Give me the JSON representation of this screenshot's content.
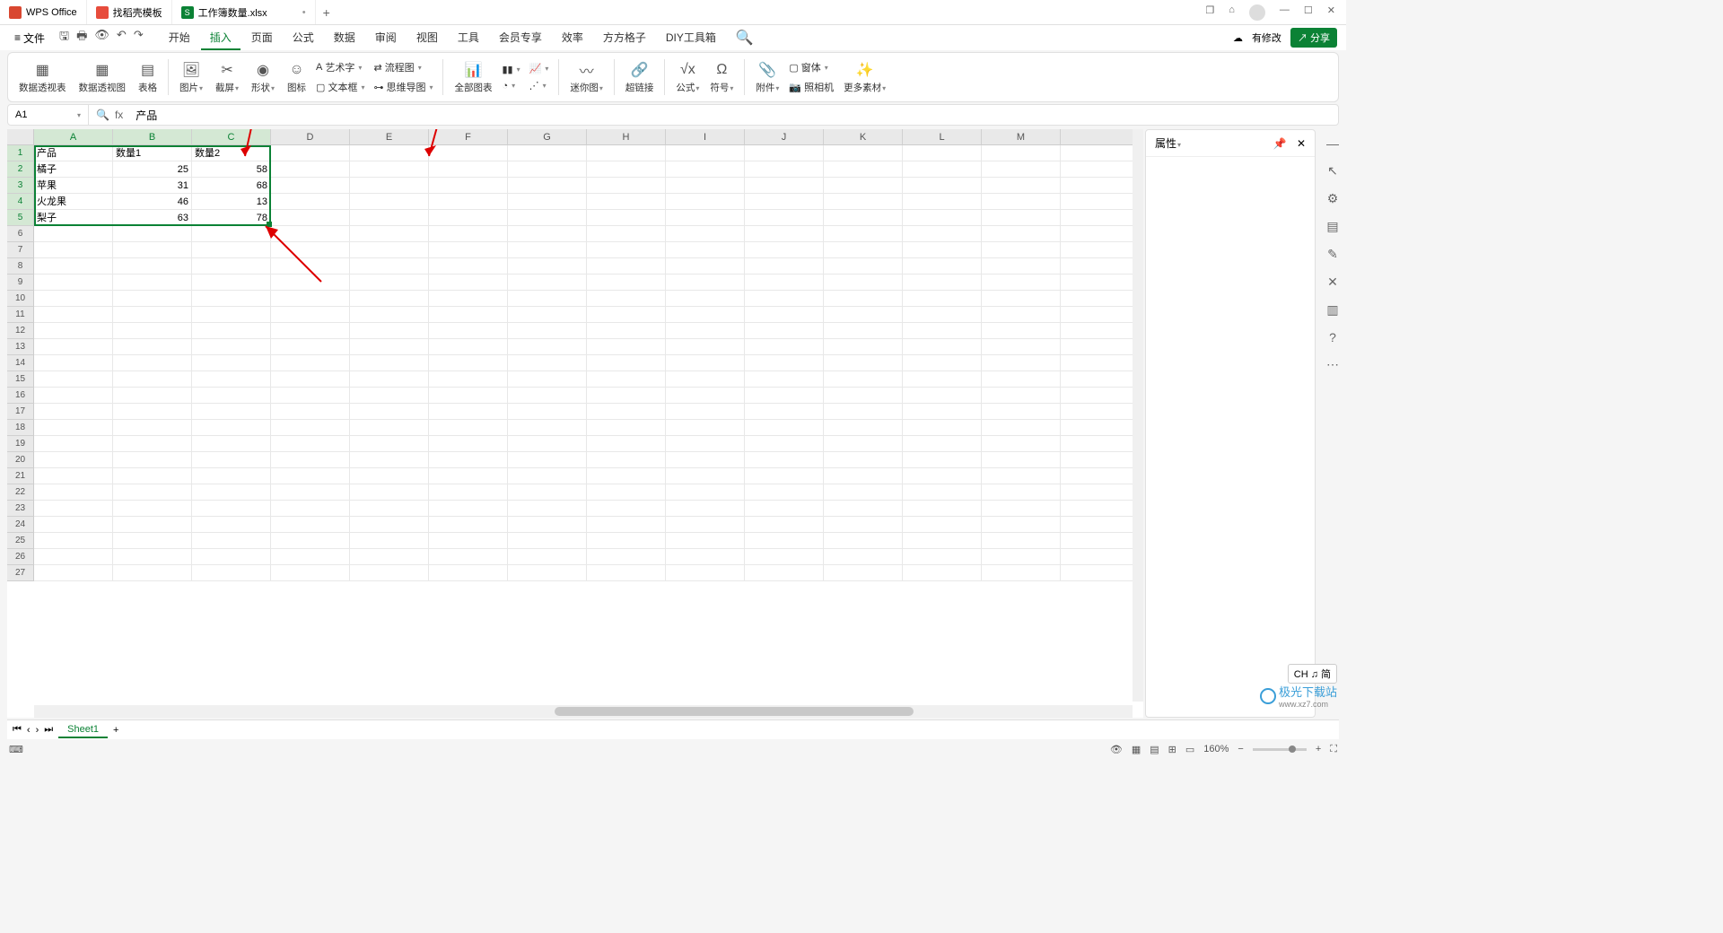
{
  "titlebar": {
    "app_name": "WPS Office",
    "tab_template": "找稻壳模板",
    "tab_file": "工作簿数量.xlsx",
    "add": "+"
  },
  "menubar": {
    "file": "文件",
    "tabs": [
      "开始",
      "插入",
      "页面",
      "公式",
      "数据",
      "审阅",
      "视图",
      "工具",
      "会员专享",
      "效率",
      "方方格子",
      "DIY工具箱"
    ],
    "active_index": 1,
    "has_changes": "有修改",
    "share": "分享"
  },
  "ribbon": {
    "pivot_table": "数据透视表",
    "pivot_chart": "数据透视图",
    "table": "表格",
    "picture": "图片",
    "screenshot": "截屏",
    "shapes": "形状",
    "icons": "图标",
    "wordart": "艺术字",
    "textbox": "文本框",
    "flowchart": "流程图",
    "mindmap": "思维导图",
    "all_charts": "全部图表",
    "sparkline": "迷你图",
    "hyperlink": "超链接",
    "formula": "公式",
    "symbol": "符号",
    "attach": "附件",
    "form": "窗体",
    "camera": "照相机",
    "more": "更多素材"
  },
  "formula_bar": {
    "cell_ref": "A1",
    "content": "产品"
  },
  "chart_data": {
    "type": "table",
    "headers": [
      "产品",
      "数量1",
      "数量2"
    ],
    "rows": [
      [
        "橘子",
        25,
        58
      ],
      [
        "苹果",
        31,
        68
      ],
      [
        "火龙果",
        46,
        13
      ],
      [
        "梨子",
        63,
        78
      ]
    ]
  },
  "columns": [
    "A",
    "B",
    "C",
    "D",
    "E",
    "F",
    "G",
    "H",
    "I",
    "J",
    "K",
    "L",
    "M"
  ],
  "row_count": 27,
  "rpane": {
    "title": "属性"
  },
  "sheetbar": {
    "tab": "Sheet1",
    "add": "+"
  },
  "statusbar": {
    "zoom": "160%",
    "ime": "CH ♫ 简"
  },
  "watermark": {
    "name": "极光下载站",
    "url": "www.xz7.com"
  }
}
